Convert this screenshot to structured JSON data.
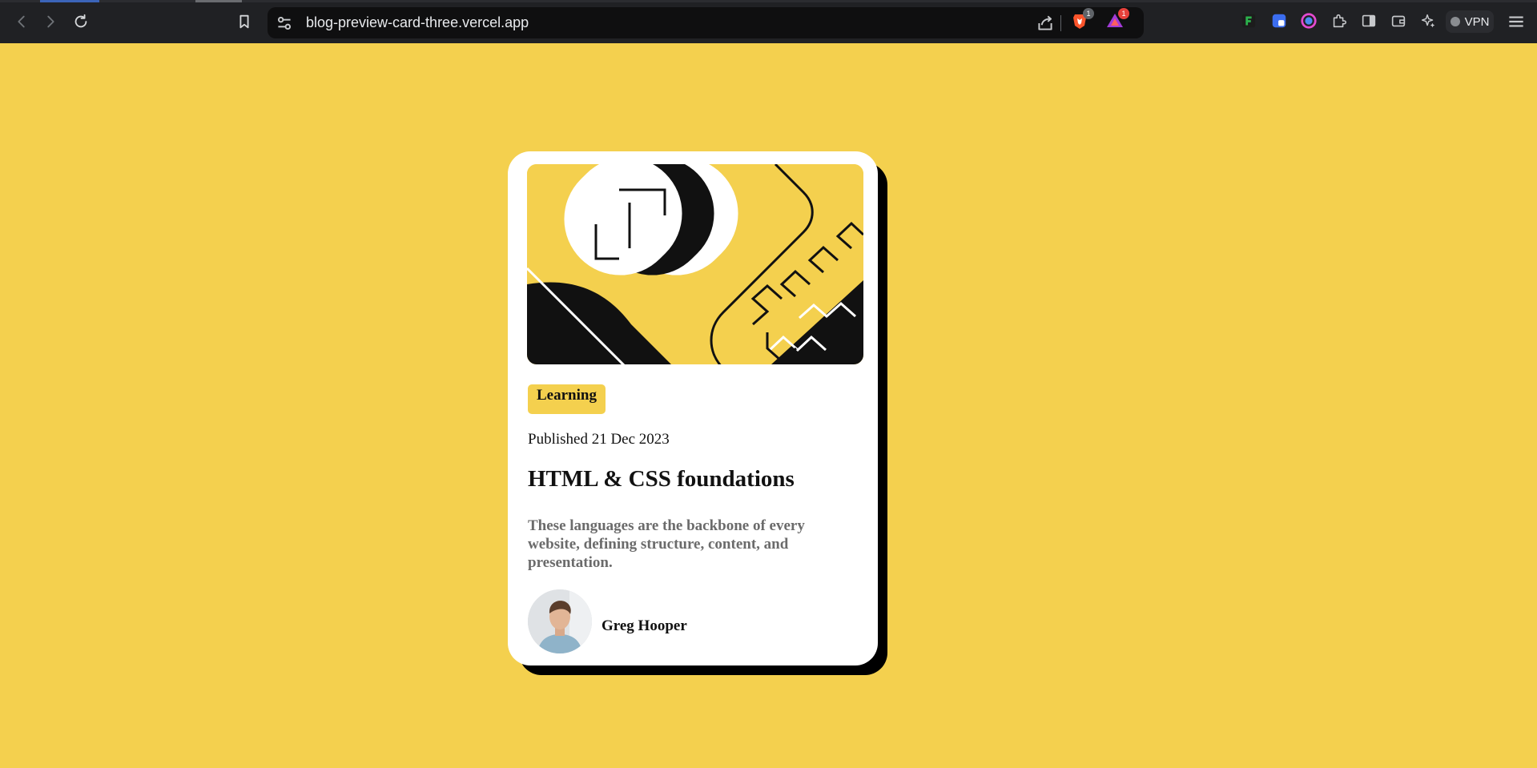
{
  "browser": {
    "url": "blog-preview-card-three.vercel.app",
    "vpn_label": "VPN",
    "brave_shield_count": "1",
    "rewards_count": "1"
  },
  "card": {
    "tag": "Learning",
    "published": "Published 21 Dec 2023",
    "title": "HTML & CSS foundations",
    "description": "These languages are the backbone of every website, defining structure, content, and presentation.",
    "author": "Greg Hooper"
  },
  "colors": {
    "page_background": "#f4d04e",
    "card_background": "#ffffff",
    "card_shadow": "#000000",
    "tag_background": "#f4d04e",
    "description_text": "#6b6b6b",
    "chrome_background": "#202124"
  }
}
